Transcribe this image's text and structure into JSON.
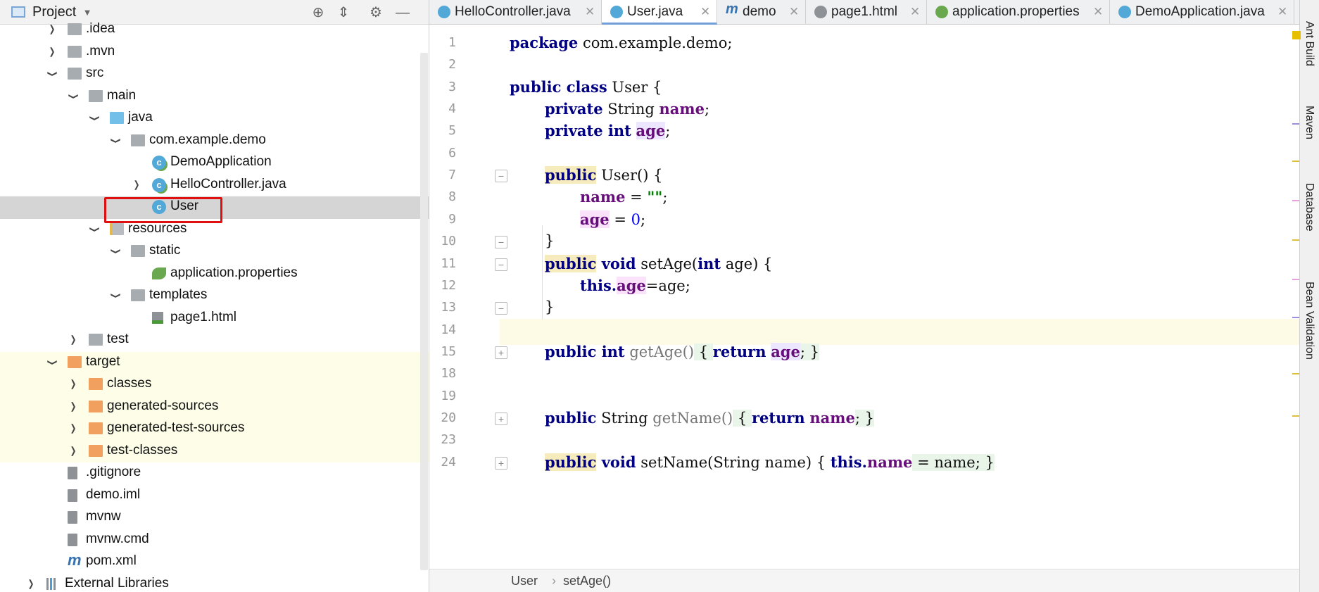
{
  "project_panel": {
    "title": "Project",
    "tree": [
      {
        "label": ".idea",
        "indent": 1,
        "arrow": "›",
        "icon": "folder-icon"
      },
      {
        "label": ".mvn",
        "indent": 1,
        "arrow": "›",
        "icon": "folder-icon"
      },
      {
        "label": "src",
        "indent": 1,
        "arrow": "⌄",
        "icon": "folder-icon"
      },
      {
        "label": "main",
        "indent": 2,
        "arrow": "⌄",
        "icon": "folder-icon"
      },
      {
        "label": "java",
        "indent": 3,
        "arrow": "⌄",
        "icon": "source-folder-icon"
      },
      {
        "label": "com.example.demo",
        "indent": 4,
        "arrow": "⌄",
        "icon": "package-icon"
      },
      {
        "label": "DemoApplication",
        "indent": 5,
        "arrow": "",
        "icon": "spring-class-icon"
      },
      {
        "label": "HelloController.java",
        "indent": 5,
        "arrow": "›",
        "icon": "spring-class-icon"
      },
      {
        "label": "User",
        "indent": 5,
        "arrow": "",
        "icon": "class-icon",
        "selected": true
      },
      {
        "label": "resources",
        "indent": 3,
        "arrow": "⌄",
        "icon": "resources-folder-icon"
      },
      {
        "label": "static",
        "indent": 4,
        "arrow": "⌄",
        "icon": "package-icon"
      },
      {
        "label": "application.properties",
        "indent": 5,
        "arrow": "",
        "icon": "spring-leaf-icon"
      },
      {
        "label": "templates",
        "indent": 4,
        "arrow": "⌄",
        "icon": "package-icon"
      },
      {
        "label": "page1.html",
        "indent": 5,
        "arrow": "",
        "icon": "html-file-icon"
      },
      {
        "label": "test",
        "indent": 2,
        "arrow": "›",
        "icon": "folder-icon"
      },
      {
        "label": "target",
        "indent": 1,
        "arrow": "⌄",
        "icon": "excluded-folder-icon",
        "excluded": true
      },
      {
        "label": "classes",
        "indent": 2,
        "arrow": "›",
        "icon": "excluded-folder-icon",
        "excluded": true
      },
      {
        "label": "generated-sources",
        "indent": 2,
        "arrow": "›",
        "icon": "excluded-folder-icon",
        "excluded": true
      },
      {
        "label": "generated-test-sources",
        "indent": 2,
        "arrow": "›",
        "icon": "excluded-folder-icon",
        "excluded": true
      },
      {
        "label": "test-classes",
        "indent": 2,
        "arrow": "›",
        "icon": "excluded-folder-icon",
        "excluded": true
      },
      {
        "label": ".gitignore",
        "indent": 1,
        "arrow": "",
        "icon": "text-file-icon"
      },
      {
        "label": "demo.iml",
        "indent": 1,
        "arrow": "",
        "icon": "iml-file-icon"
      },
      {
        "label": "mvnw",
        "indent": 1,
        "arrow": "",
        "icon": "text-file-icon"
      },
      {
        "label": "mvnw.cmd",
        "indent": 1,
        "arrow": "",
        "icon": "text-file-icon"
      },
      {
        "label": "pom.xml",
        "indent": 1,
        "arrow": "",
        "icon": "maven-icon"
      },
      {
        "label": "External Libraries",
        "indent": 0,
        "arrow": "›",
        "icon": "libraries-icon"
      }
    ]
  },
  "tabs": [
    {
      "label": "HelloController.java",
      "icon": "spring-class-icon",
      "active": false
    },
    {
      "label": "User.java",
      "icon": "class-icon",
      "active": true
    },
    {
      "label": "demo",
      "icon": "maven-icon",
      "active": false
    },
    {
      "label": "page1.html",
      "icon": "html-file-icon",
      "active": false
    },
    {
      "label": "application.properties",
      "icon": "spring-leaf-icon",
      "active": false
    },
    {
      "label": "DemoApplication.java",
      "icon": "spring-class-icon",
      "active": false
    }
  ],
  "editor": {
    "line_numbers": [
      "1",
      "2",
      "3",
      "4",
      "5",
      "6",
      "7",
      "8",
      "9",
      "10",
      "11",
      "12",
      "13",
      "14",
      "15",
      "18",
      "19",
      "20",
      "23",
      "24"
    ],
    "lines": {
      "l1": "package com.example.demo;",
      "l3": "public class User {",
      "l4_kw": "private",
      "l4_type": " String ",
      "l4_fld": "name",
      "l4_end": ";",
      "l5_kw": "private int",
      "l5_fld": "age",
      "l5_end": ";",
      "l7_kw": "public",
      "l7_rest": " User() {",
      "l8_fld": "name",
      "l8_mid": " = ",
      "l8_str": "\"\"",
      "l8_end": ";",
      "l9_fld": "age",
      "l9_mid": " = ",
      "l9_num": "0",
      "l9_end": ";",
      "l10": "}",
      "l11_kw": "public void",
      "l11_rest": " setAge(",
      "l11_kw2": "int",
      "l11_end": " age) {",
      "l12_kw": "this.",
      "l12_fld": "age",
      "l12_end": "=age;",
      "l13": "}",
      "l15_kw": "public int",
      "l15_m": " getAge()",
      "l15_b": " { ",
      "l15_kw2": "return",
      "l15_fld": "age",
      "l15_end": "; }",
      "l20_kw": "public",
      "l20_t": " String ",
      "l20_m": "getName()",
      "l20_b": " { ",
      "l20_kw2": "return",
      "l20_fld": "name",
      "l20_end": "; }",
      "l24_kw": "public void",
      "l24_m": " setName(String name) { ",
      "l24_kw2": "this.",
      "l24_fld": "name",
      "l24_end": " = name; }"
    }
  },
  "breadcrumb": {
    "item1": "User",
    "sep": "›",
    "item2": "setAge()"
  },
  "right_strip": [
    "Ant Build",
    "Maven",
    "Database",
    "Bean Validation"
  ],
  "colors": {
    "keyword": "#000080",
    "field": "#660e7a",
    "number": "#0000ff",
    "string": "#008000",
    "selection_box": "#e01010"
  }
}
